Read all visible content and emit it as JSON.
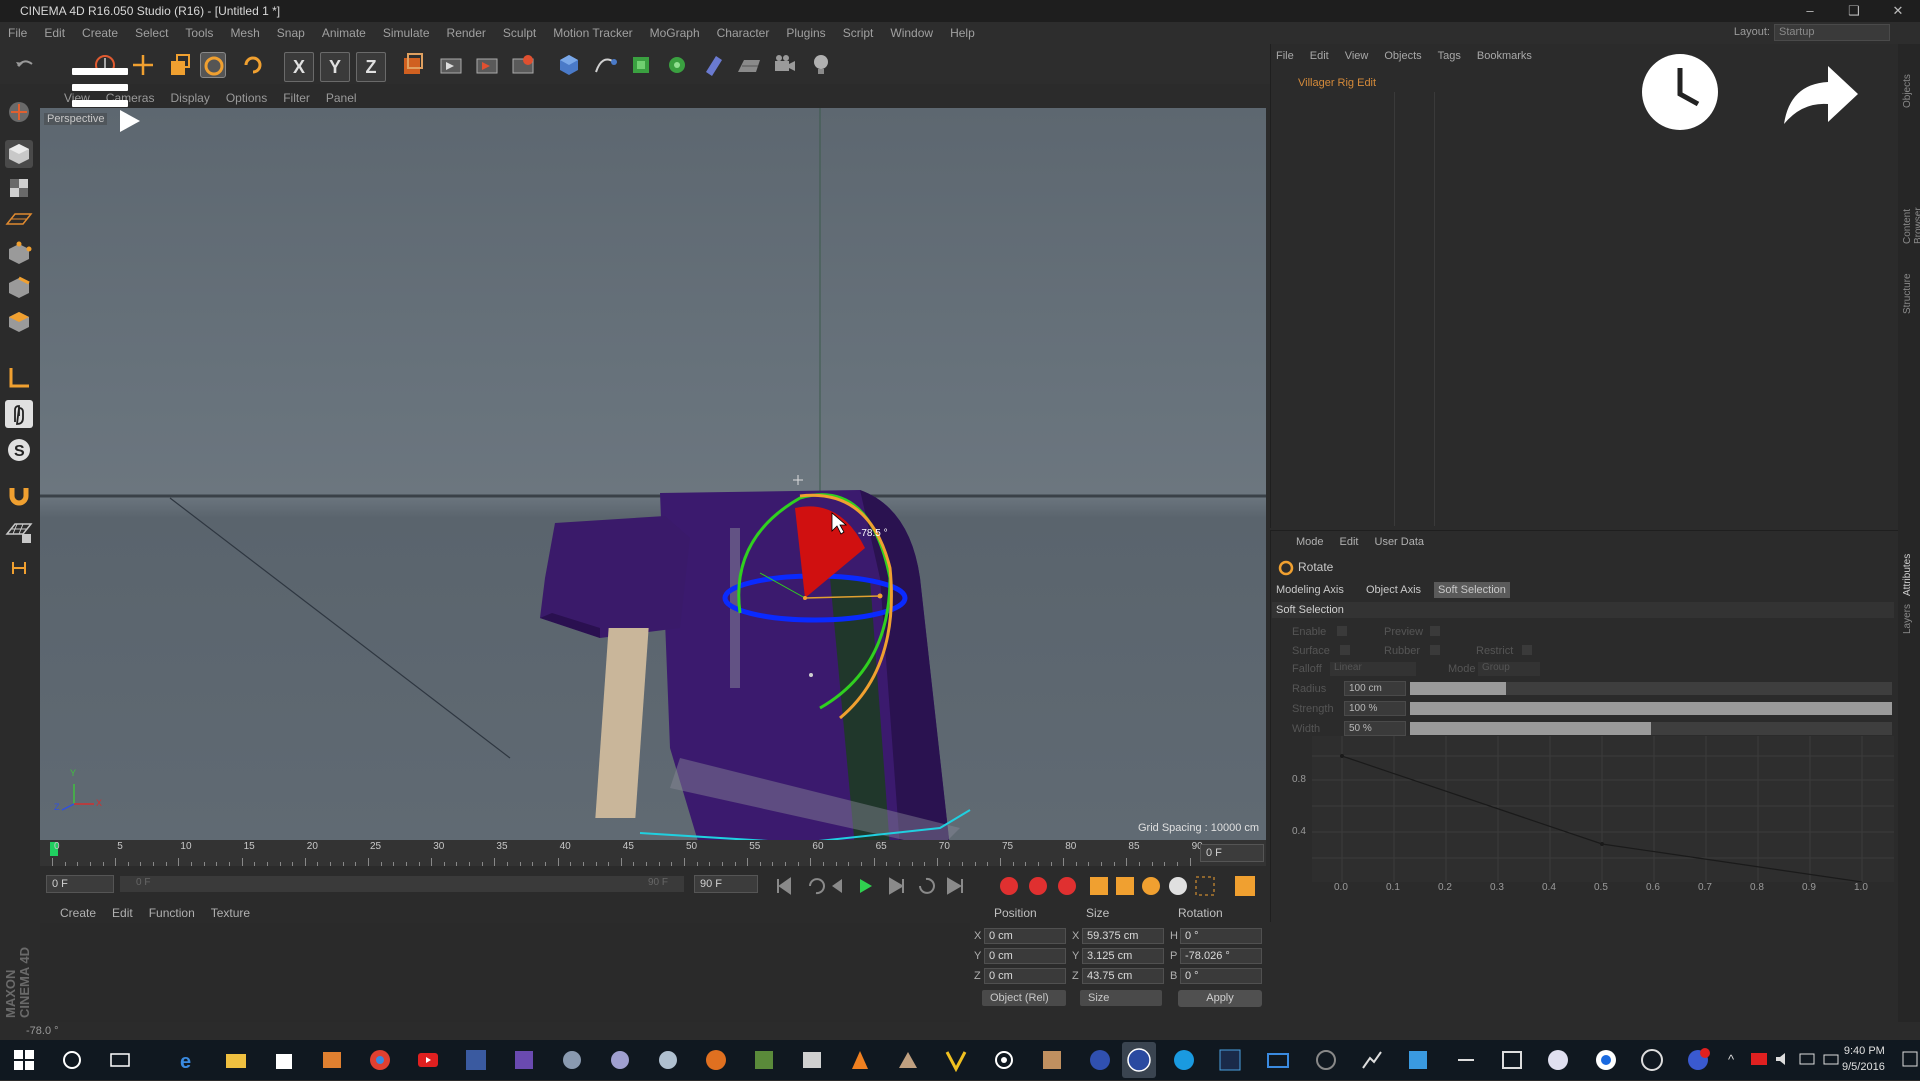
{
  "window": {
    "title": "CINEMA 4D R16.050 Studio (R16) - [Untitled 1 *]",
    "controls": [
      "–",
      "❑",
      "✕"
    ]
  },
  "menubar": [
    "File",
    "Edit",
    "Create",
    "Select",
    "Tools",
    "Mesh",
    "Snap",
    "Animate",
    "Simulate",
    "Render",
    "Sculpt",
    "Motion Tracker",
    "MoGraph",
    "Character",
    "Plugins",
    "Script",
    "Window",
    "Help"
  ],
  "layout": {
    "label": "Layout:",
    "value": "Startup"
  },
  "toolbar": {
    "axis_x": "X",
    "axis_y": "Y",
    "axis_z": "Z"
  },
  "viewport": {
    "menu": [
      "View",
      "Cameras",
      "Display",
      "Options",
      "Filter",
      "Panel"
    ],
    "camera_label": "Perspective",
    "grid_spacing": "Grid Spacing : 10000 cm",
    "rotation_readout": "-78.5 °",
    "axis_x": "X",
    "axis_y": "Y",
    "axis_z": "Z"
  },
  "timeline": {
    "ticks": [
      "0",
      "5",
      "10",
      "15",
      "20",
      "25",
      "30",
      "35",
      "40",
      "45",
      "50",
      "55",
      "60",
      "65",
      "70",
      "75",
      "80",
      "85",
      "90"
    ],
    "current_frame": "0 F",
    "start_frame": "0 F",
    "range_start": "0 F",
    "range_end": "90 F",
    "end_frame": "90 F"
  },
  "material_manager": {
    "menu": [
      "Create",
      "Edit",
      "Function",
      "Texture"
    ]
  },
  "coordinates": {
    "headers": [
      "Position",
      "Size",
      "Rotation"
    ],
    "axis_labels": [
      "X",
      "Y",
      "Z"
    ],
    "size_labels": [
      "X",
      "Y",
      "Z"
    ],
    "rot_labels": [
      "H",
      "P",
      "B"
    ],
    "position": [
      "0 cm",
      "0 cm",
      "0 cm"
    ],
    "size": [
      "59.375 cm",
      "3.125 cm",
      "43.75 cm"
    ],
    "rotation": [
      "0 °",
      "-78.026 °",
      "0 °"
    ],
    "mode_select": "Object (Rel)",
    "size_select": "Size",
    "apply_label": "Apply"
  },
  "status": {
    "text": "-78.0 °"
  },
  "logo": {
    "line1": "MAXON",
    "line2": "CINEMA 4D"
  },
  "object_manager": {
    "menu": [
      "File",
      "Edit",
      "View",
      "Objects",
      "Tags",
      "Bookmarks"
    ],
    "object_name": "Villager Rig Edit"
  },
  "attributes": {
    "menu": [
      "Mode",
      "Edit",
      "User Data"
    ],
    "tool_name": "Rotate",
    "tabs": [
      "Modeling Axis",
      "Object Axis",
      "Soft Selection"
    ],
    "active_tab": "Soft Selection",
    "section": "Soft Selection",
    "enable_label": "Enable",
    "preview_label": "Preview",
    "surface_label": "Surface",
    "rubber_label": "Rubber",
    "restrict_label": "Restrict",
    "falloff_label": "Falloff",
    "falloff_value": "Linear",
    "mode_label": "Mode",
    "mode_value": "Group",
    "radius_label": "Radius",
    "radius_value": "100 cm",
    "radius_fill": 0.2,
    "strength_label": "Strength",
    "strength_value": "100 %",
    "strength_fill": 1.0,
    "width_label": "Width",
    "width_value": "50 %",
    "width_fill": 0.5,
    "graph_x_ticks": [
      "0.0",
      "0.1",
      "0.2",
      "0.3",
      "0.4",
      "0.5",
      "0.6",
      "0.7",
      "0.8",
      "0.9",
      "1.0"
    ],
    "graph_y_ticks": [
      "0.8",
      "0.4"
    ]
  },
  "side_tabs": [
    "Objects",
    "Content Browser",
    "Structure",
    "Attributes",
    "Layers"
  ],
  "taskbar": {
    "time": "9:40 PM",
    "date": "9/5/2016"
  }
}
